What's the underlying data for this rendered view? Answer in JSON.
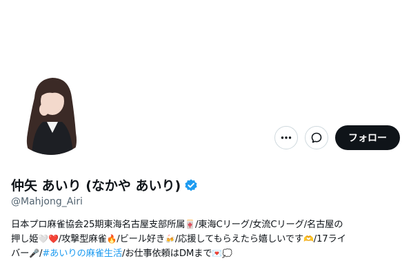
{
  "profile": {
    "display_name": "仲矢 あいり (なかや あいり)",
    "handle": "@Mahjong_Airi",
    "verified": true,
    "verified_color": "#1d9bf0"
  },
  "actions": {
    "more_icon": "more-horizontal-icon",
    "message_icon": "message-bubble-icon",
    "follow_label": "フォロー"
  },
  "bio": {
    "line1": {
      "text_a": "日本プロ麻雀協会25期東海名古屋支部所属",
      "emoji_a": "🀄",
      "text_b": "/東海Cリーグ/女流Cリーグ/名古屋の"
    },
    "line2": {
      "text_a": "押し姫",
      "emoji_a": "🤍❤️",
      "text_b": "/攻撃型麻雀",
      "emoji_b": "🔥",
      "text_c": "/ビール好き",
      "emoji_c": "🍻",
      "text_d": "/応援してもらえたら嬉しいです",
      "emoji_d": "🫶",
      "text_e": "/17ライ"
    },
    "line3": {
      "text_a": "バー",
      "emoji_a": "🎤",
      "text_b": "/",
      "hashtag": "#あいりの麻雀生活",
      "text_c": "/お仕事依頼はDMまで",
      "emoji_c": "💌💭"
    }
  },
  "colors": {
    "text": "#0f1419",
    "secondary": "#536471",
    "link": "#1d9bf0",
    "follow_bg": "#0f1419"
  }
}
